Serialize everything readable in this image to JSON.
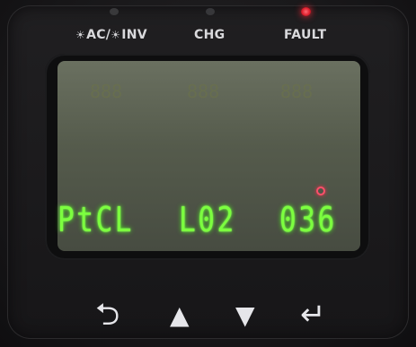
{
  "indicators": {
    "ac_inv_label": "AC/",
    "inv_label": "INV",
    "chg_label": "CHG",
    "fault_label": "FAULT"
  },
  "icons": {
    "sun": "☀",
    "back": "⮌",
    "up": "▲",
    "down": "▼",
    "enter": "↵"
  },
  "display": {
    "segment_1": "PtCL",
    "segment_2": "L02",
    "segment_3": "036"
  },
  "colors": {
    "segment_text": "#7cff3f",
    "fault_led": "#e0202e",
    "lcd_background": "#5a604f"
  }
}
